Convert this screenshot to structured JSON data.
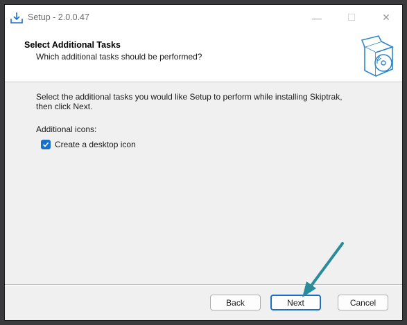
{
  "window": {
    "title": "Setup - 2.0.0.47",
    "minimize_glyph": "—",
    "maximize_glyph": "☐",
    "close_glyph": "✕"
  },
  "header": {
    "title": "Select Additional Tasks",
    "subtitle": "Which additional tasks should be performed?"
  },
  "content": {
    "intro_line1": "Select the additional tasks you would like Setup to perform while installing Skiptrak,",
    "intro_line2": "then click Next.",
    "section_label": "Additional icons:",
    "tasks": [
      {
        "label": "Create a desktop icon",
        "checked": true
      }
    ]
  },
  "buttons": {
    "back": "Back",
    "next": "Next",
    "cancel": "Cancel"
  },
  "colors": {
    "accent": "#1a6fc9",
    "annotation_arrow": "#2a8c9a"
  }
}
